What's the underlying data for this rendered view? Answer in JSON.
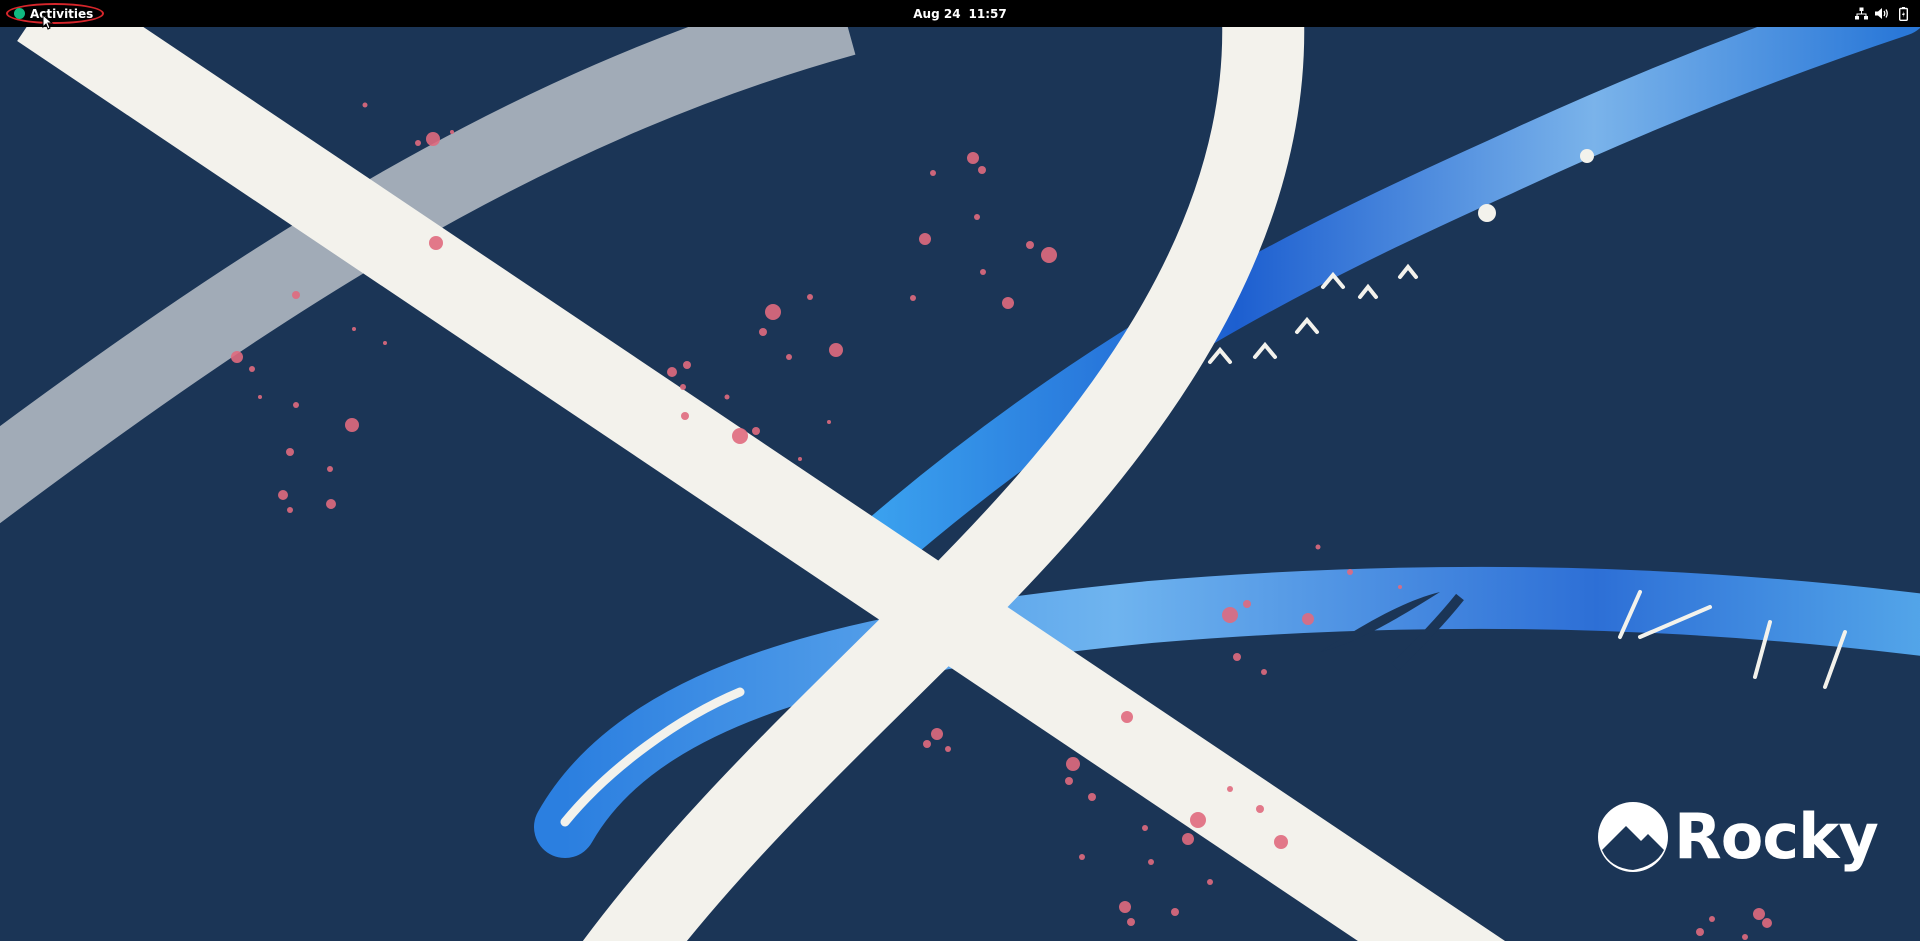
{
  "topbar": {
    "activities_label": "Activities",
    "clock_date": "Aug 24",
    "clock_time": "11:57",
    "tray_icons": [
      "network-icon",
      "volume-icon",
      "battery-icon"
    ]
  },
  "desktop": {
    "wallpaper_brand": "Rocky",
    "colors": {
      "background": "#1b3556",
      "stroke": "#f3f2ec",
      "accent_blue": "#2f7fd8",
      "splatter": "#e06a7e",
      "logo_green": "#10b981",
      "highlight_ring": "#d7262b"
    }
  }
}
